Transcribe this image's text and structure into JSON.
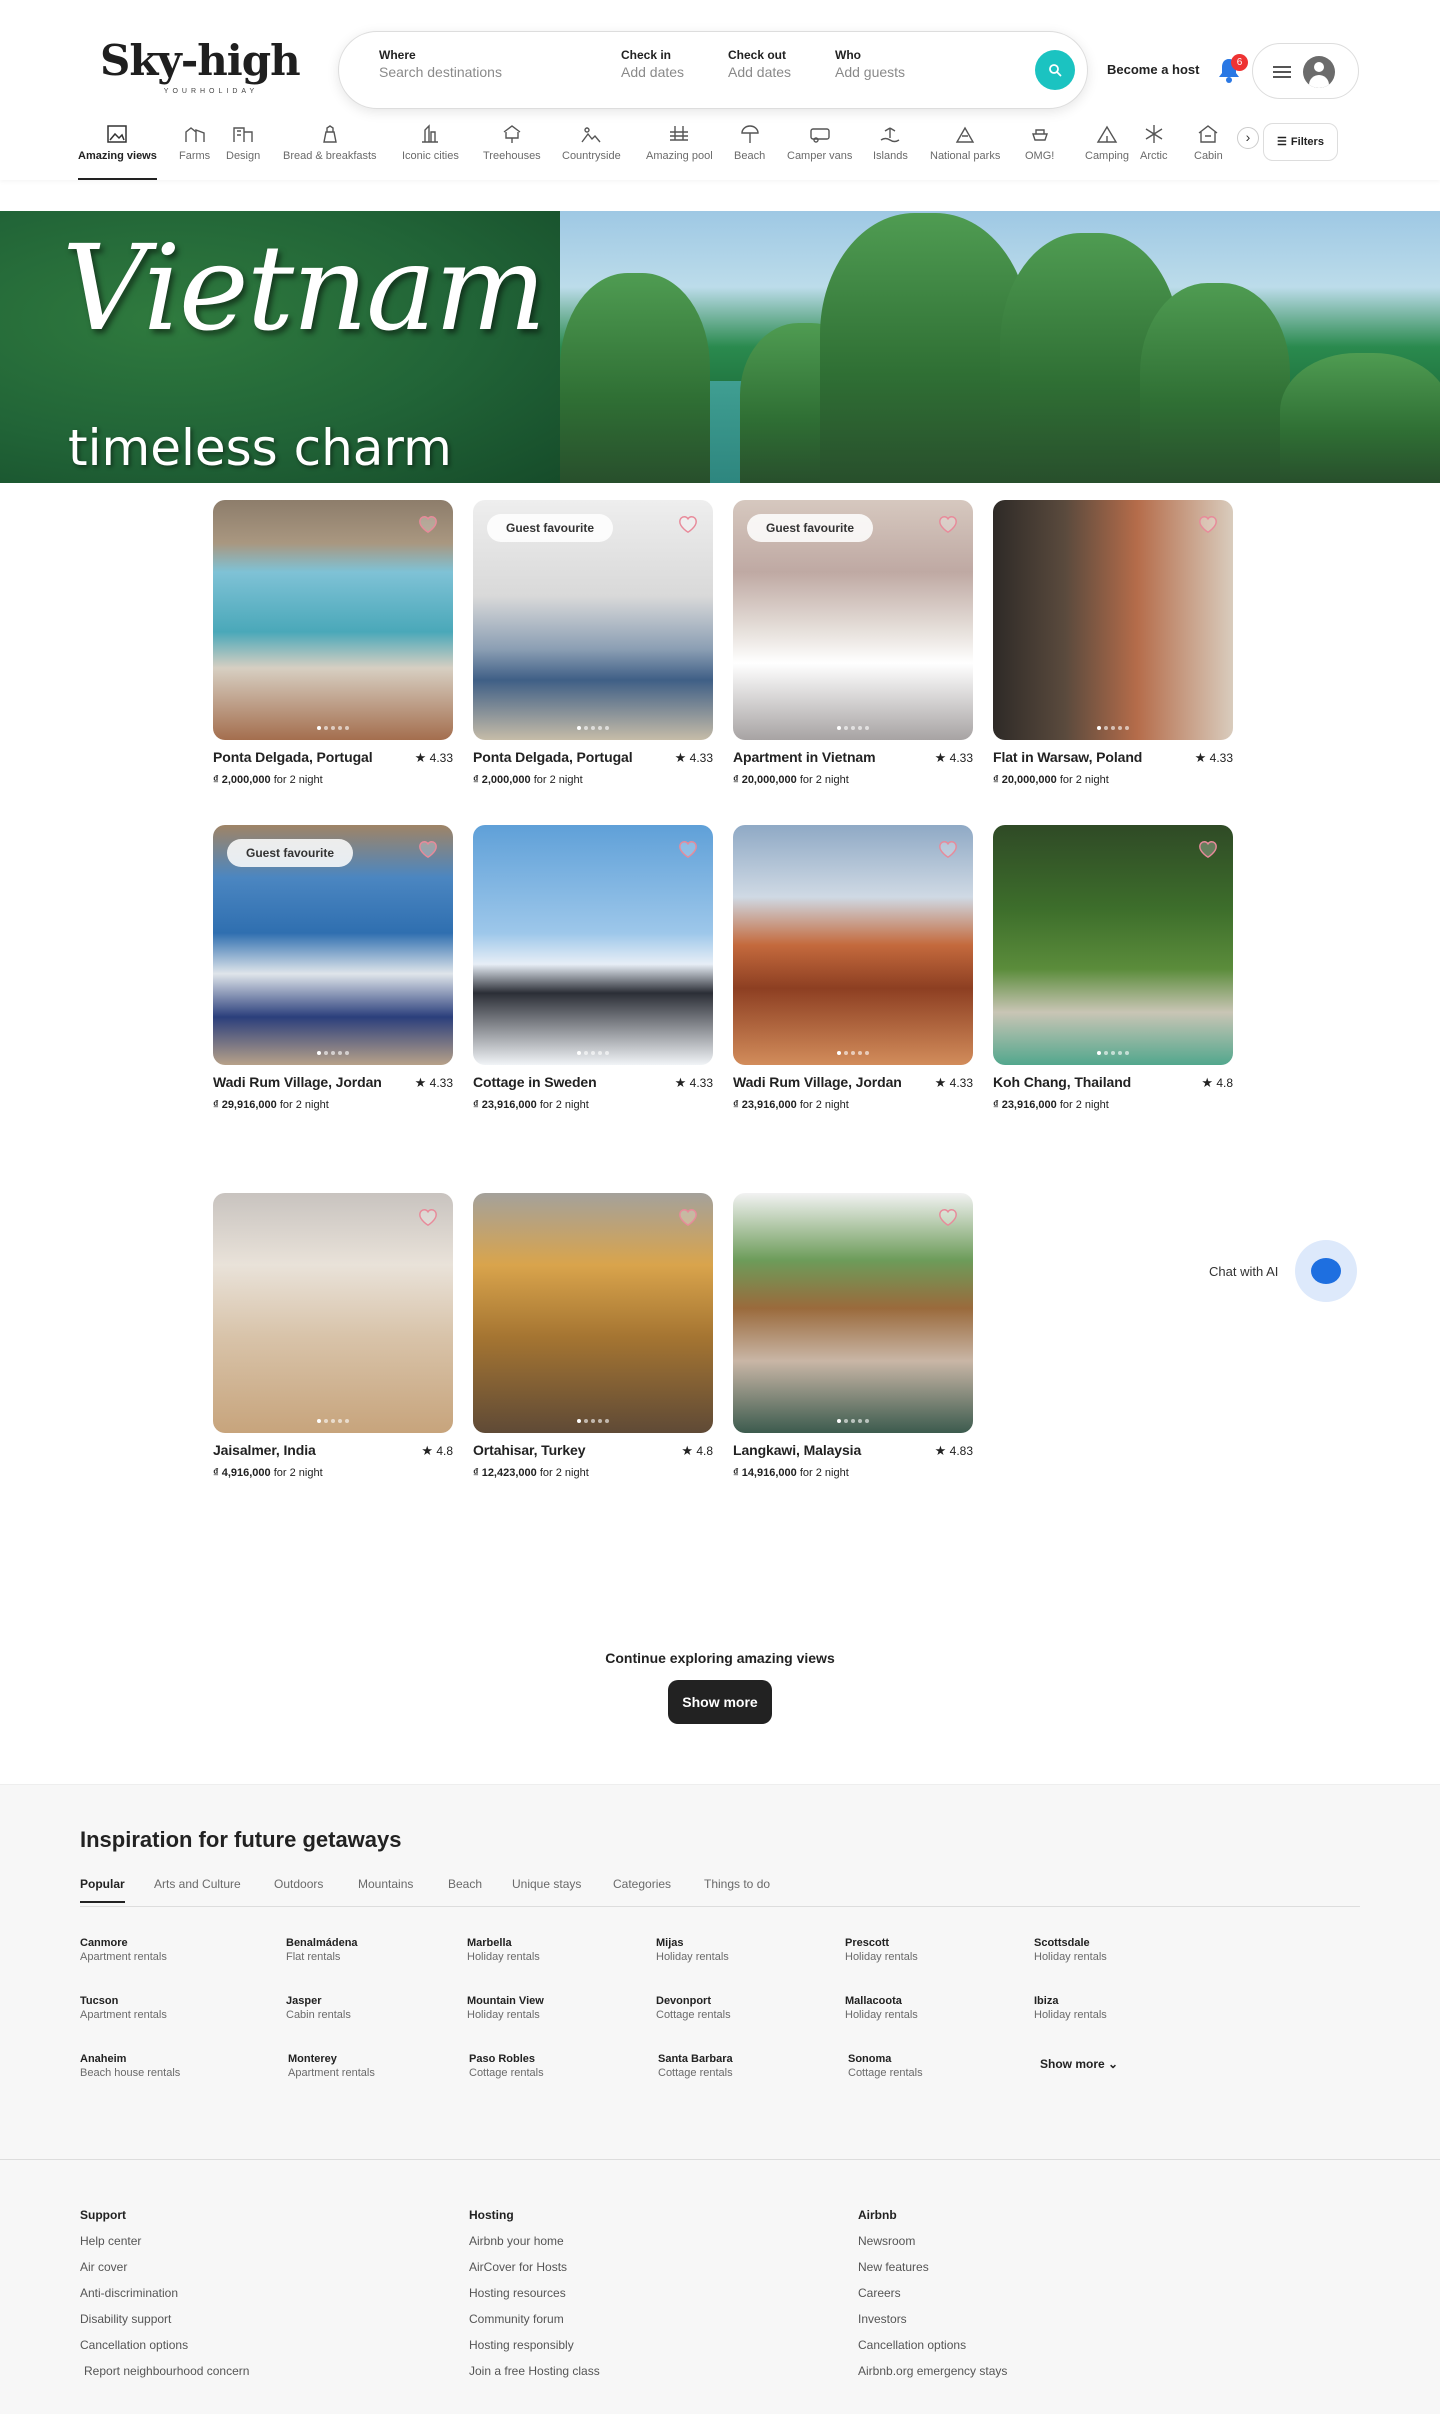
{
  "brand": {
    "name": "Sky-high",
    "tagline": "YOURHOLIDAY"
  },
  "search": {
    "where_label": "Where",
    "where_placeholder": "Search destinations",
    "checkin_label": "Check in",
    "checkin_value": "Add dates",
    "checkout_label": "Check out",
    "checkout_value": "Add dates",
    "who_label": "Who",
    "who_value": "Add guests"
  },
  "header": {
    "become_host": "Become a host",
    "notification_count": "6",
    "filters": "Filters"
  },
  "categories": [
    {
      "label": "Amazing views",
      "icon": "amazing-views-icon"
    },
    {
      "label": "Farms",
      "icon": "farms-icon"
    },
    {
      "label": "Design",
      "icon": "design-icon"
    },
    {
      "label": "Bread & breakfasts",
      "icon": "bread-breakfasts-icon"
    },
    {
      "label": "Iconic cities",
      "icon": "iconic-cities-icon"
    },
    {
      "label": "Treehouses",
      "icon": "treehouses-icon"
    },
    {
      "label": "Countryside",
      "icon": "countryside-icon"
    },
    {
      "label": "Amazing pool",
      "icon": "amazing-pool-icon"
    },
    {
      "label": "Beach",
      "icon": "beach-icon"
    },
    {
      "label": "Camper vans",
      "icon": "camper-vans-icon"
    },
    {
      "label": "Islands",
      "icon": "islands-icon"
    },
    {
      "label": "National parks",
      "icon": "national-parks-icon"
    },
    {
      "label": "OMG!",
      "icon": "omg-icon"
    },
    {
      "label": "Camping",
      "icon": "camping-icon"
    },
    {
      "label": "Arctic",
      "icon": "arctic-icon"
    },
    {
      "label": "Cabin",
      "icon": "cabin-icon"
    }
  ],
  "banner": {
    "title": "Vietnam",
    "subtitle": "timeless charm"
  },
  "listings": [
    {
      "name": "Ponta Delgada, Portugal",
      "rating": "4.33",
      "price": "₫ 2,000,000",
      "price_suffix": "for 2 night",
      "badge": ""
    },
    {
      "name": "Ponta Delgada, Portugal",
      "rating": "4.33",
      "price": "₫ 2,000,000",
      "price_suffix": "for 2 night",
      "badge": "Guest favourite"
    },
    {
      "name": "Apartment in Vietnam",
      "rating": "4.33",
      "price": "₫ 20,000,000",
      "price_suffix": "for 2 night",
      "badge": "Guest favourite"
    },
    {
      "name": "Flat in Warsaw, Poland",
      "rating": "4.33",
      "price": "₫ 20,000,000",
      "price_suffix": "for 2 night",
      "badge": ""
    },
    {
      "name": "Wadi Rum Village, Jordan",
      "rating": "4.33",
      "price": "₫ 29,916,000",
      "price_suffix": "for 2 night",
      "badge": "Guest favourite"
    },
    {
      "name": "Cottage in Sweden",
      "rating": "4.33",
      "price": "₫ 23,916,000",
      "price_suffix": "for 2 night",
      "badge": ""
    },
    {
      "name": "Wadi  Rum Village, Jordan",
      "rating": "4.33",
      "price": "₫ 23,916,000",
      "price_suffix": "for 2 night",
      "badge": ""
    },
    {
      "name": "Koh Chang, Thailand",
      "rating": "4.8",
      "price": "₫ 23,916,000",
      "price_suffix": "for 2 night",
      "badge": ""
    },
    {
      "name": "Jaisalmer, India",
      "rating": "4.8",
      "price": "₫ 4,916,000",
      "price_suffix": "for 2 night",
      "badge": ""
    },
    {
      "name": "Ortahisar, Turkey",
      "rating": "4.8",
      "price": "₫ 12,423,000",
      "price_suffix": "for 2 night",
      "badge": ""
    },
    {
      "name": "Langkawi, Malaysia",
      "rating": "4.83",
      "price": "₫ 14,916,000",
      "price_suffix": "for 2 night",
      "badge": ""
    }
  ],
  "chat": {
    "label": "Chat with AI"
  },
  "more": {
    "title": "Continue exploring amazing views",
    "button": "Show more"
  },
  "inspiration": {
    "title": "Inspiration for future getaways",
    "tabs": [
      "Popular",
      "Arts and Culture",
      "Outdoors",
      "Mountains",
      "Beach",
      "Unique stays",
      "Categories",
      "Things to do"
    ],
    "destinations": [
      {
        "name": "Canmore",
        "type": "Apartment rentals"
      },
      {
        "name": "Benalmádena",
        "type": "Flat rentals"
      },
      {
        "name": "Marbella",
        "type": "Holiday rentals"
      },
      {
        "name": "Mijas",
        "type": "Holiday rentals"
      },
      {
        "name": "Prescott",
        "type": "Holiday rentals"
      },
      {
        "name": "Scottsdale",
        "type": "Holiday rentals"
      },
      {
        "name": "Tucson",
        "type": "Apartment rentals"
      },
      {
        "name": "Jasper",
        "type": "Cabin rentals"
      },
      {
        "name": "Mountain View",
        "type": "Holiday rentals"
      },
      {
        "name": "Devonport",
        "type": "Cottage rentals"
      },
      {
        "name": "Mallacoota",
        "type": "Holiday rentals"
      },
      {
        "name": "Ibiza",
        "type": "Holiday rentals"
      },
      {
        "name": "Anaheim",
        "type": "Beach house rentals"
      },
      {
        "name": "Monterey",
        "type": "Apartment rentals"
      },
      {
        "name": "Paso Robles",
        "type": "Cottage rentals"
      },
      {
        "name": "Santa Barbara",
        "type": "Cottage rentals"
      },
      {
        "name": "Sonoma",
        "type": "Cottage rentals"
      }
    ],
    "show_more": "Show more"
  },
  "footer": {
    "columns": [
      {
        "heading": "Support",
        "links": [
          "Help center",
          "Air cover",
          "Anti-discrimination",
          "Disability support",
          "Cancellation options",
          "Report neighbourhood concern"
        ]
      },
      {
        "heading": "Hosting",
        "links": [
          "Airbnb your home",
          "AirCover for Hosts",
          "Hosting resources",
          "Community forum",
          "Hosting responsibly",
          "Join a free Hosting class"
        ]
      },
      {
        "heading": "Airbnb",
        "links": [
          "Newsroom",
          "New features",
          "Careers",
          "Investors",
          "Cancellation options",
          "Airbnb.org emergency stays"
        ]
      }
    ]
  },
  "colors": {
    "accent": "#1bc3c1",
    "badge": "#e33333",
    "heart": "#e88a9a",
    "chat": "#1e6fe0"
  }
}
